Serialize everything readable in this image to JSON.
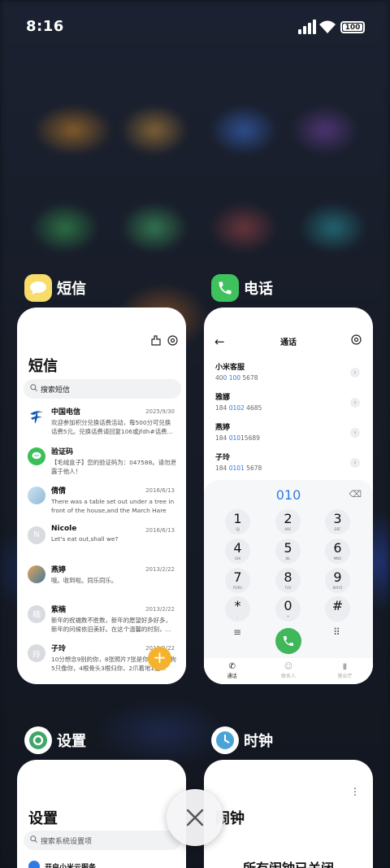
{
  "status_bar": {
    "time": "8:16",
    "battery": "100"
  },
  "recents": {
    "sms": {
      "app_name": "短信",
      "title": "短信",
      "search_placeholder": "搜索短信",
      "messages": [
        {
          "name": "中国电信",
          "date": "2025/9/30",
          "text": "欢迎参加积分兑换话费活动，每500分可兑换话费5元。兑换话费请回复106或jfdh#话费..."
        },
        {
          "name": "验证码",
          "date": "",
          "text": "【毛绒盒子】您的验证码为：047588。请勿泄露于他人！"
        },
        {
          "name": "倩倩",
          "date": "2016/6/13",
          "text": "There was a table set out under a tree in front of the house,and the March Hare an..."
        },
        {
          "name": "Nicole",
          "date": "2016/6/13",
          "text": "Let's eat out,shall we?",
          "initial": "N"
        },
        {
          "name": "燕婷",
          "date": "2013/2/22",
          "text": "哦。收到啦。同乐同乐。"
        },
        {
          "name": "紫楠",
          "date": "2013/2/22",
          "text": "新年的祝福数不胜数，新年的愿望好多好多，新年的问候依旧美好。在这个温馨的时刻，...",
          "initial": "楠"
        },
        {
          "name": "子玲",
          "date": "2013/2/22",
          "text": "10分想念9别的你，8张照片7张是你，6只小狗5只像你，4根骨头3根归你，2爪着地1定...",
          "initial": "玲"
        }
      ],
      "fab": "+"
    },
    "phone": {
      "app_name": "电话",
      "title": "通话",
      "contacts": [
        {
          "name": "小米客服",
          "num_pre": "40",
          "num_hl": "0 100",
          "num_post": " 5678"
        },
        {
          "name": "雅娜",
          "num_pre": "184 ",
          "num_hl": "0102",
          "num_post": " 4685"
        },
        {
          "name": "燕婷",
          "num_pre": "184 ",
          "num_hl": "010",
          "num_post": "15689"
        },
        {
          "name": "子玲",
          "num_pre": "184 ",
          "num_hl": "0101",
          "num_post": " 5678"
        }
      ],
      "dialed": "010",
      "keys": [
        {
          "d": "1",
          "l": "QJ"
        },
        {
          "d": "2",
          "l": "ABC"
        },
        {
          "d": "3",
          "l": "DEF"
        },
        {
          "d": "4",
          "l": "GHI"
        },
        {
          "d": "5",
          "l": "JKL"
        },
        {
          "d": "6",
          "l": "MNO"
        },
        {
          "d": "7",
          "l": "PQRS"
        },
        {
          "d": "8",
          "l": "TUV"
        },
        {
          "d": "9",
          "l": "WXYZ"
        },
        {
          "d": "*",
          "l": ","
        },
        {
          "d": "0",
          "l": "+"
        },
        {
          "d": "#",
          "l": ""
        }
      ],
      "tabs": [
        "通话",
        "联系人",
        "营业厅"
      ]
    },
    "settings": {
      "app_name": "设置",
      "title": "设置",
      "search_placeholder": "搜索系统设置项",
      "first_item": "开启小米云服务"
    },
    "clock": {
      "app_name": "时钟",
      "title": "闹钟",
      "message": "所有闹钟已关闭"
    }
  },
  "colors": {
    "accent_blue": "#2f7ae5",
    "call_green": "#3fb75a",
    "fab_orange": "#f5b22c"
  }
}
